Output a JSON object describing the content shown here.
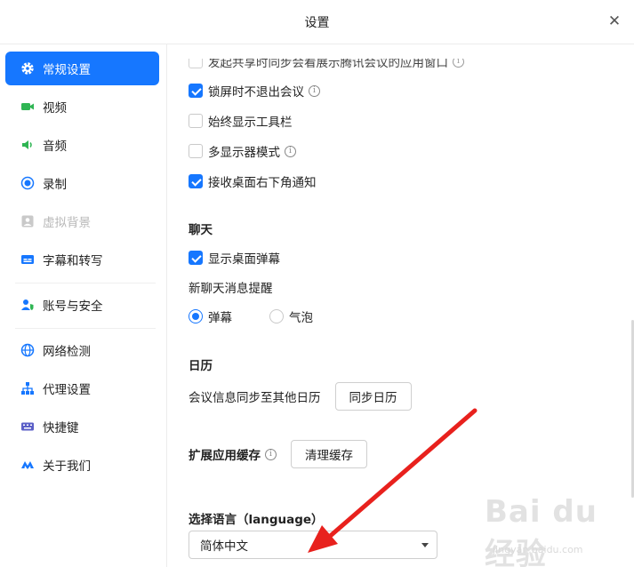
{
  "window": {
    "title": "设置",
    "close_label": "✕"
  },
  "sidebar": {
    "items": [
      {
        "label": "常规设置",
        "icon": "gear-icon",
        "active": true
      },
      {
        "label": "视频",
        "icon": "video-camera-icon"
      },
      {
        "label": "音频",
        "icon": "speaker-icon"
      },
      {
        "label": "录制",
        "icon": "record-icon"
      },
      {
        "label": "虚拟背景",
        "icon": "virtual-background-icon",
        "disabled": true
      },
      {
        "label": "字幕和转写",
        "icon": "subtitle-icon"
      },
      {
        "label": "账号与安全",
        "icon": "account-security-icon"
      },
      {
        "label": "网络检测",
        "icon": "globe-icon"
      },
      {
        "label": "代理设置",
        "icon": "proxy-network-icon"
      },
      {
        "label": "快捷键",
        "icon": "keyboard-icon"
      },
      {
        "label": "关于我们",
        "icon": "tencent-meeting-logo-icon"
      }
    ]
  },
  "general": {
    "options": [
      {
        "label": "发起共享时同步会看展示腾讯会议的应用窗口",
        "checked": false,
        "info": true,
        "partial": true
      },
      {
        "label": "锁屏时不退出会议",
        "checked": true,
        "info": true
      },
      {
        "label": "始终显示工具栏",
        "checked": false,
        "info": false
      },
      {
        "label": "多显示器模式",
        "checked": false,
        "info": true
      },
      {
        "label": "接收桌面右下角通知",
        "checked": true,
        "info": false
      }
    ]
  },
  "chat": {
    "title": "聊天",
    "show_barrage_label": "显示桌面弹幕",
    "show_barrage_checked": true,
    "reminder_label": "新聊天消息提醒",
    "reminder_options": [
      "弹幕",
      "气泡"
    ],
    "reminder_selected": 0
  },
  "calendar": {
    "title": "日历",
    "sync_label": "会议信息同步至其他日历",
    "sync_button": "同步日历"
  },
  "cache": {
    "title": "扩展应用缓存",
    "clear_button": "清理缓存"
  },
  "language": {
    "title": "选择语言（language）",
    "selected": "简体中文"
  },
  "watermark": {
    "main": "Bai du 经验",
    "sub": "jingyan.baidu.com"
  },
  "colors": {
    "accent": "#1677ff",
    "annotation_arrow": "#e8211d"
  }
}
